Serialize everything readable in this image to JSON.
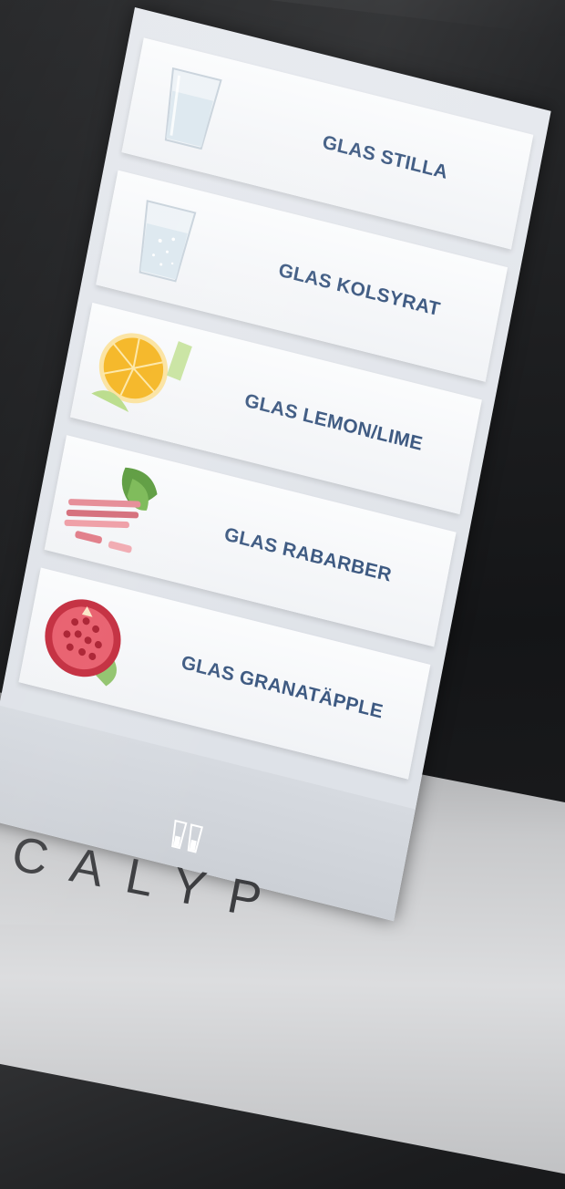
{
  "menu": {
    "items": [
      {
        "label": "GLAS STILLA",
        "icon": "still-water-glass-icon"
      },
      {
        "label": "GLAS KOLSYRAT",
        "icon": "sparkling-water-glass-icon"
      },
      {
        "label": "GLAS LEMON/LIME",
        "icon": "lemon-lime-icon"
      },
      {
        "label": "GLAS RABARBER",
        "icon": "rhubarb-icon"
      },
      {
        "label": "GLAS GRANATÄPPLE",
        "icon": "pomegranate-icon"
      }
    ]
  },
  "footer": {
    "icon": "glasses-icon"
  },
  "brand": {
    "text": "CALYP"
  },
  "colors": {
    "label": "#3e5a82",
    "screen": "#e6e9ee",
    "card": "#f7f8fa"
  }
}
